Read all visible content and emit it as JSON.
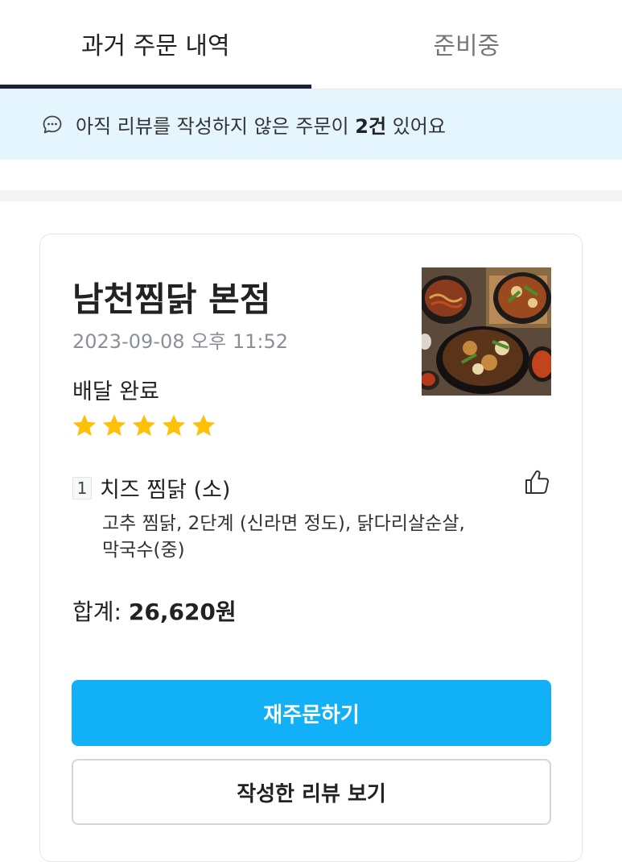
{
  "tabs": [
    {
      "label": "과거 주문 내역",
      "active": true
    },
    {
      "label": "준비중",
      "active": false
    }
  ],
  "notice": {
    "prefix": "아직 리뷰를 작성하지 않은 주문이 ",
    "count": "2건",
    "suffix": " 있어요",
    "icon": "chat-bubble-icon",
    "background": "#e4f5fd"
  },
  "order": {
    "store_name": "남천찜닭 본점",
    "date": "2023-09-08 오후 11:52",
    "status": "배달 완료",
    "rating": 5,
    "thumbnail": "food-photo",
    "items": [
      {
        "qty": "1",
        "name": "치즈 찜닭 (소)",
        "options_line1": "고추 찜닭, 2단계 (신라면 정도), 닭다리살순살,",
        "options_line2": "막국수(중)"
      }
    ],
    "total_label": "합계: ",
    "total_amount": "26,620원"
  },
  "buttons": {
    "reorder": "재주문하기",
    "view_review": "작성한 리뷰 보기"
  },
  "colors": {
    "accent": "#12b0f6",
    "star": "#ffc107",
    "tab_indicator": "#1b1f3b"
  }
}
